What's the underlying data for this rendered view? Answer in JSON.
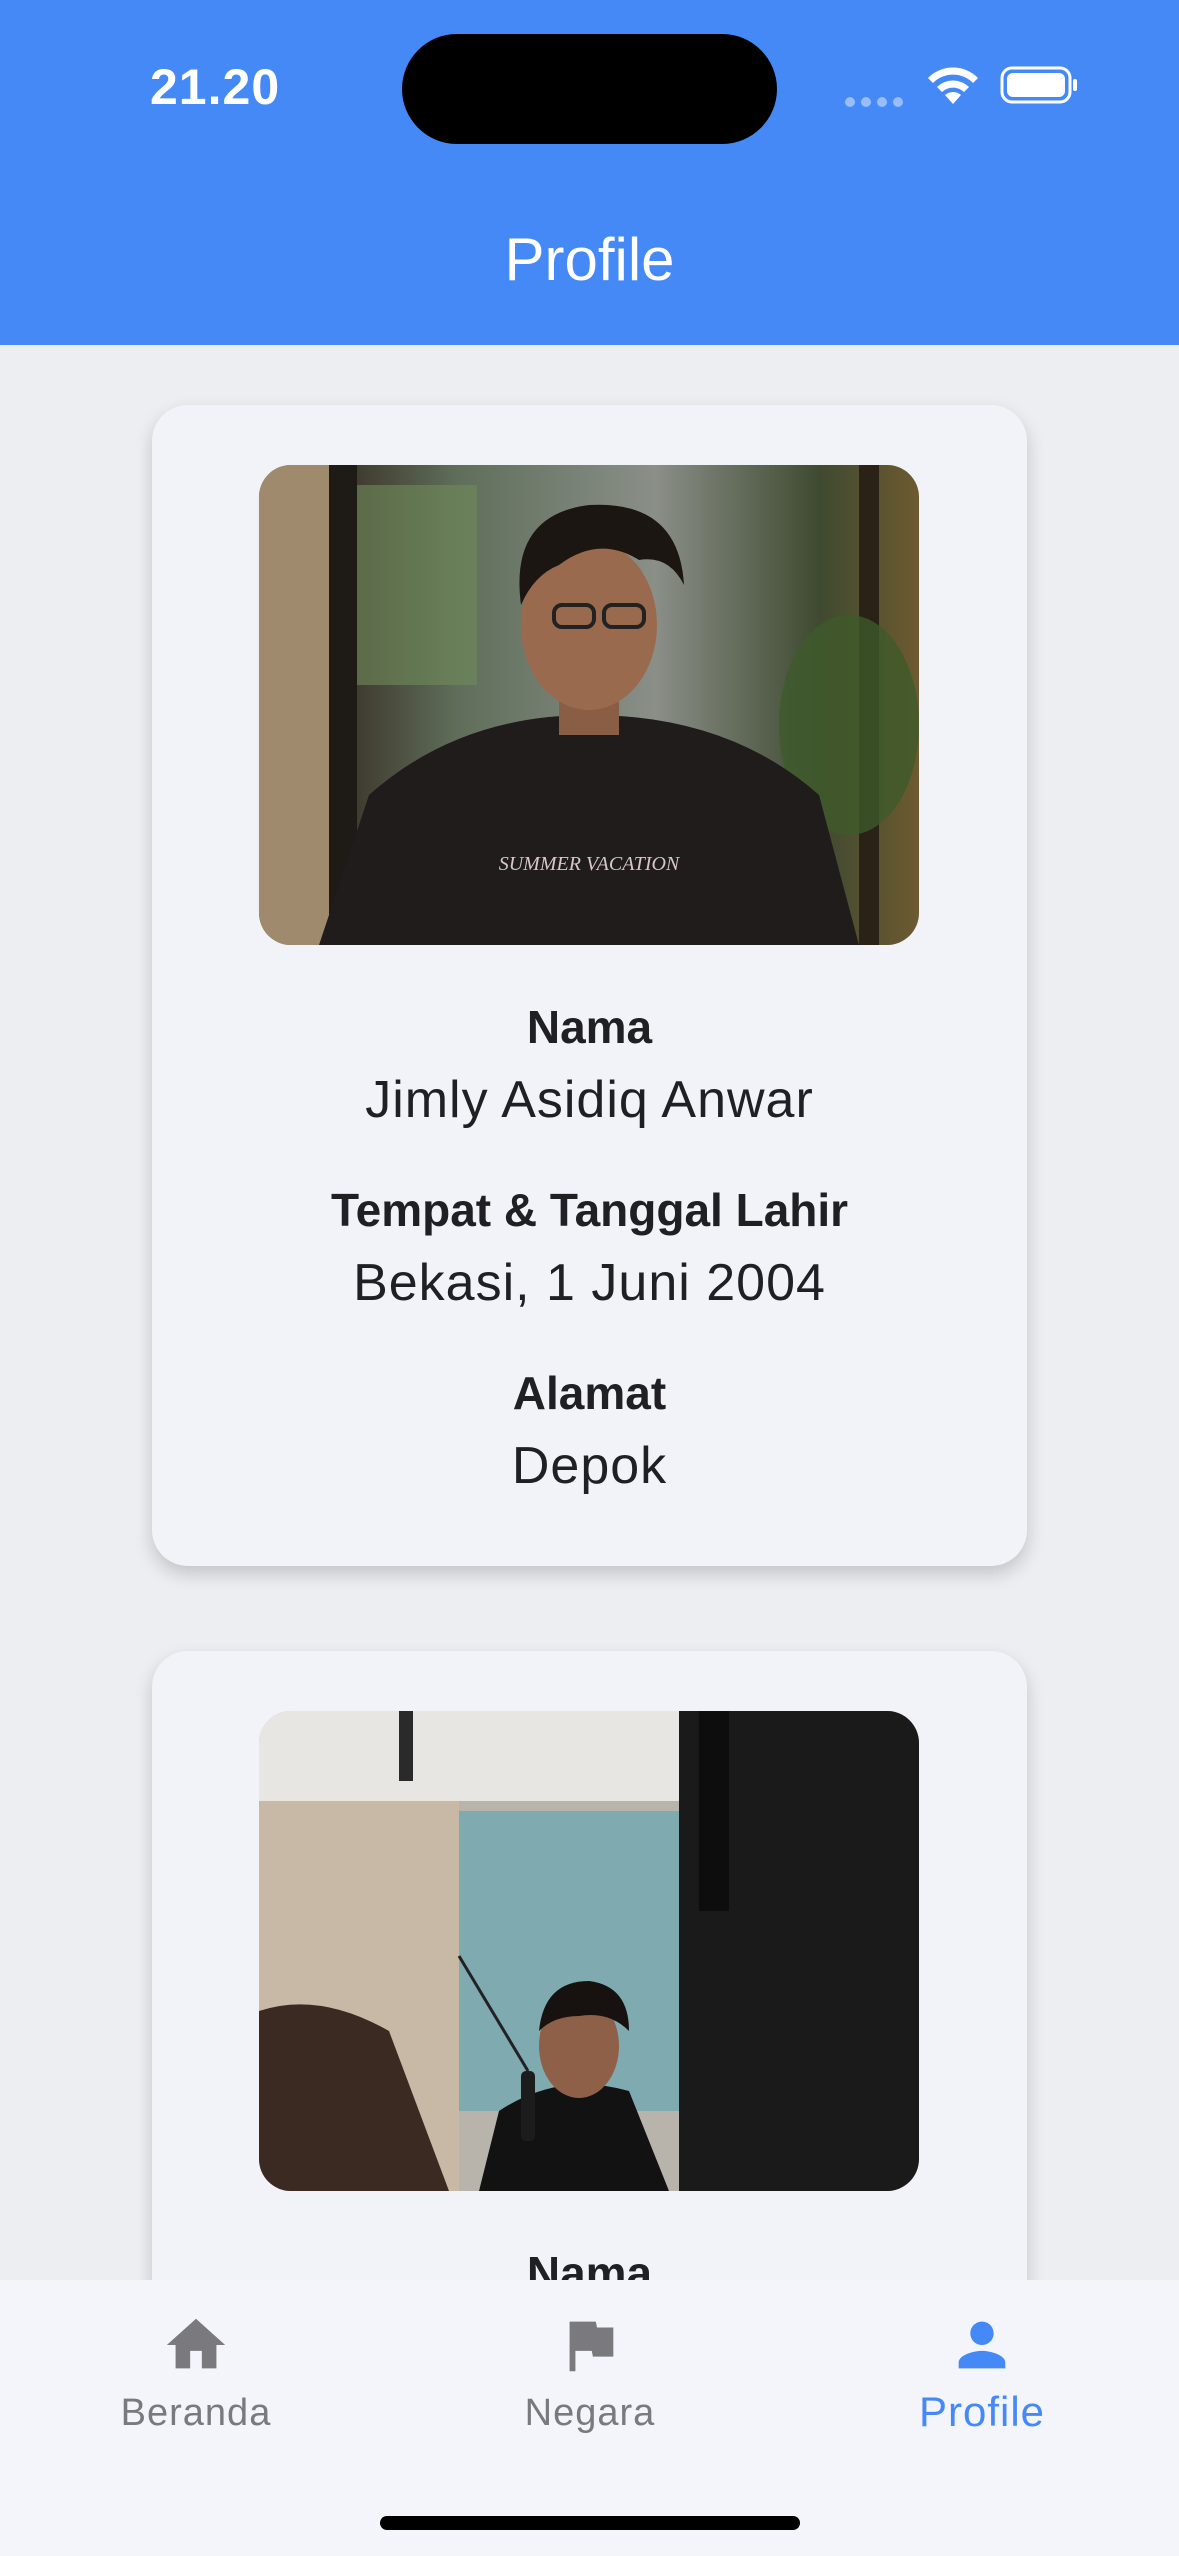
{
  "status_bar": {
    "time": "21.20"
  },
  "header": {
    "title": "Profile"
  },
  "profiles": [
    {
      "name_label": "Nama",
      "name": "Jimly Asidiq Anwar",
      "birth_label": "Tempat & Tanggal Lahir",
      "birth": "Bekasi, 1 Juni 2004",
      "address_label": "Alamat",
      "address": "Depok",
      "hoodie_text": "SUMMER VACATION"
    },
    {
      "name_label": "Nama"
    }
  ],
  "bottom_nav": {
    "items": [
      {
        "label": "Beranda",
        "icon": "home-icon"
      },
      {
        "label": "Negara",
        "icon": "flag-icon"
      },
      {
        "label": "Profile",
        "icon": "person-icon",
        "active": true
      }
    ]
  },
  "colors": {
    "primary": "#4589f7",
    "inactive": "#7a7a7e",
    "background": "#eceef2",
    "card": "#f2f3f8"
  }
}
